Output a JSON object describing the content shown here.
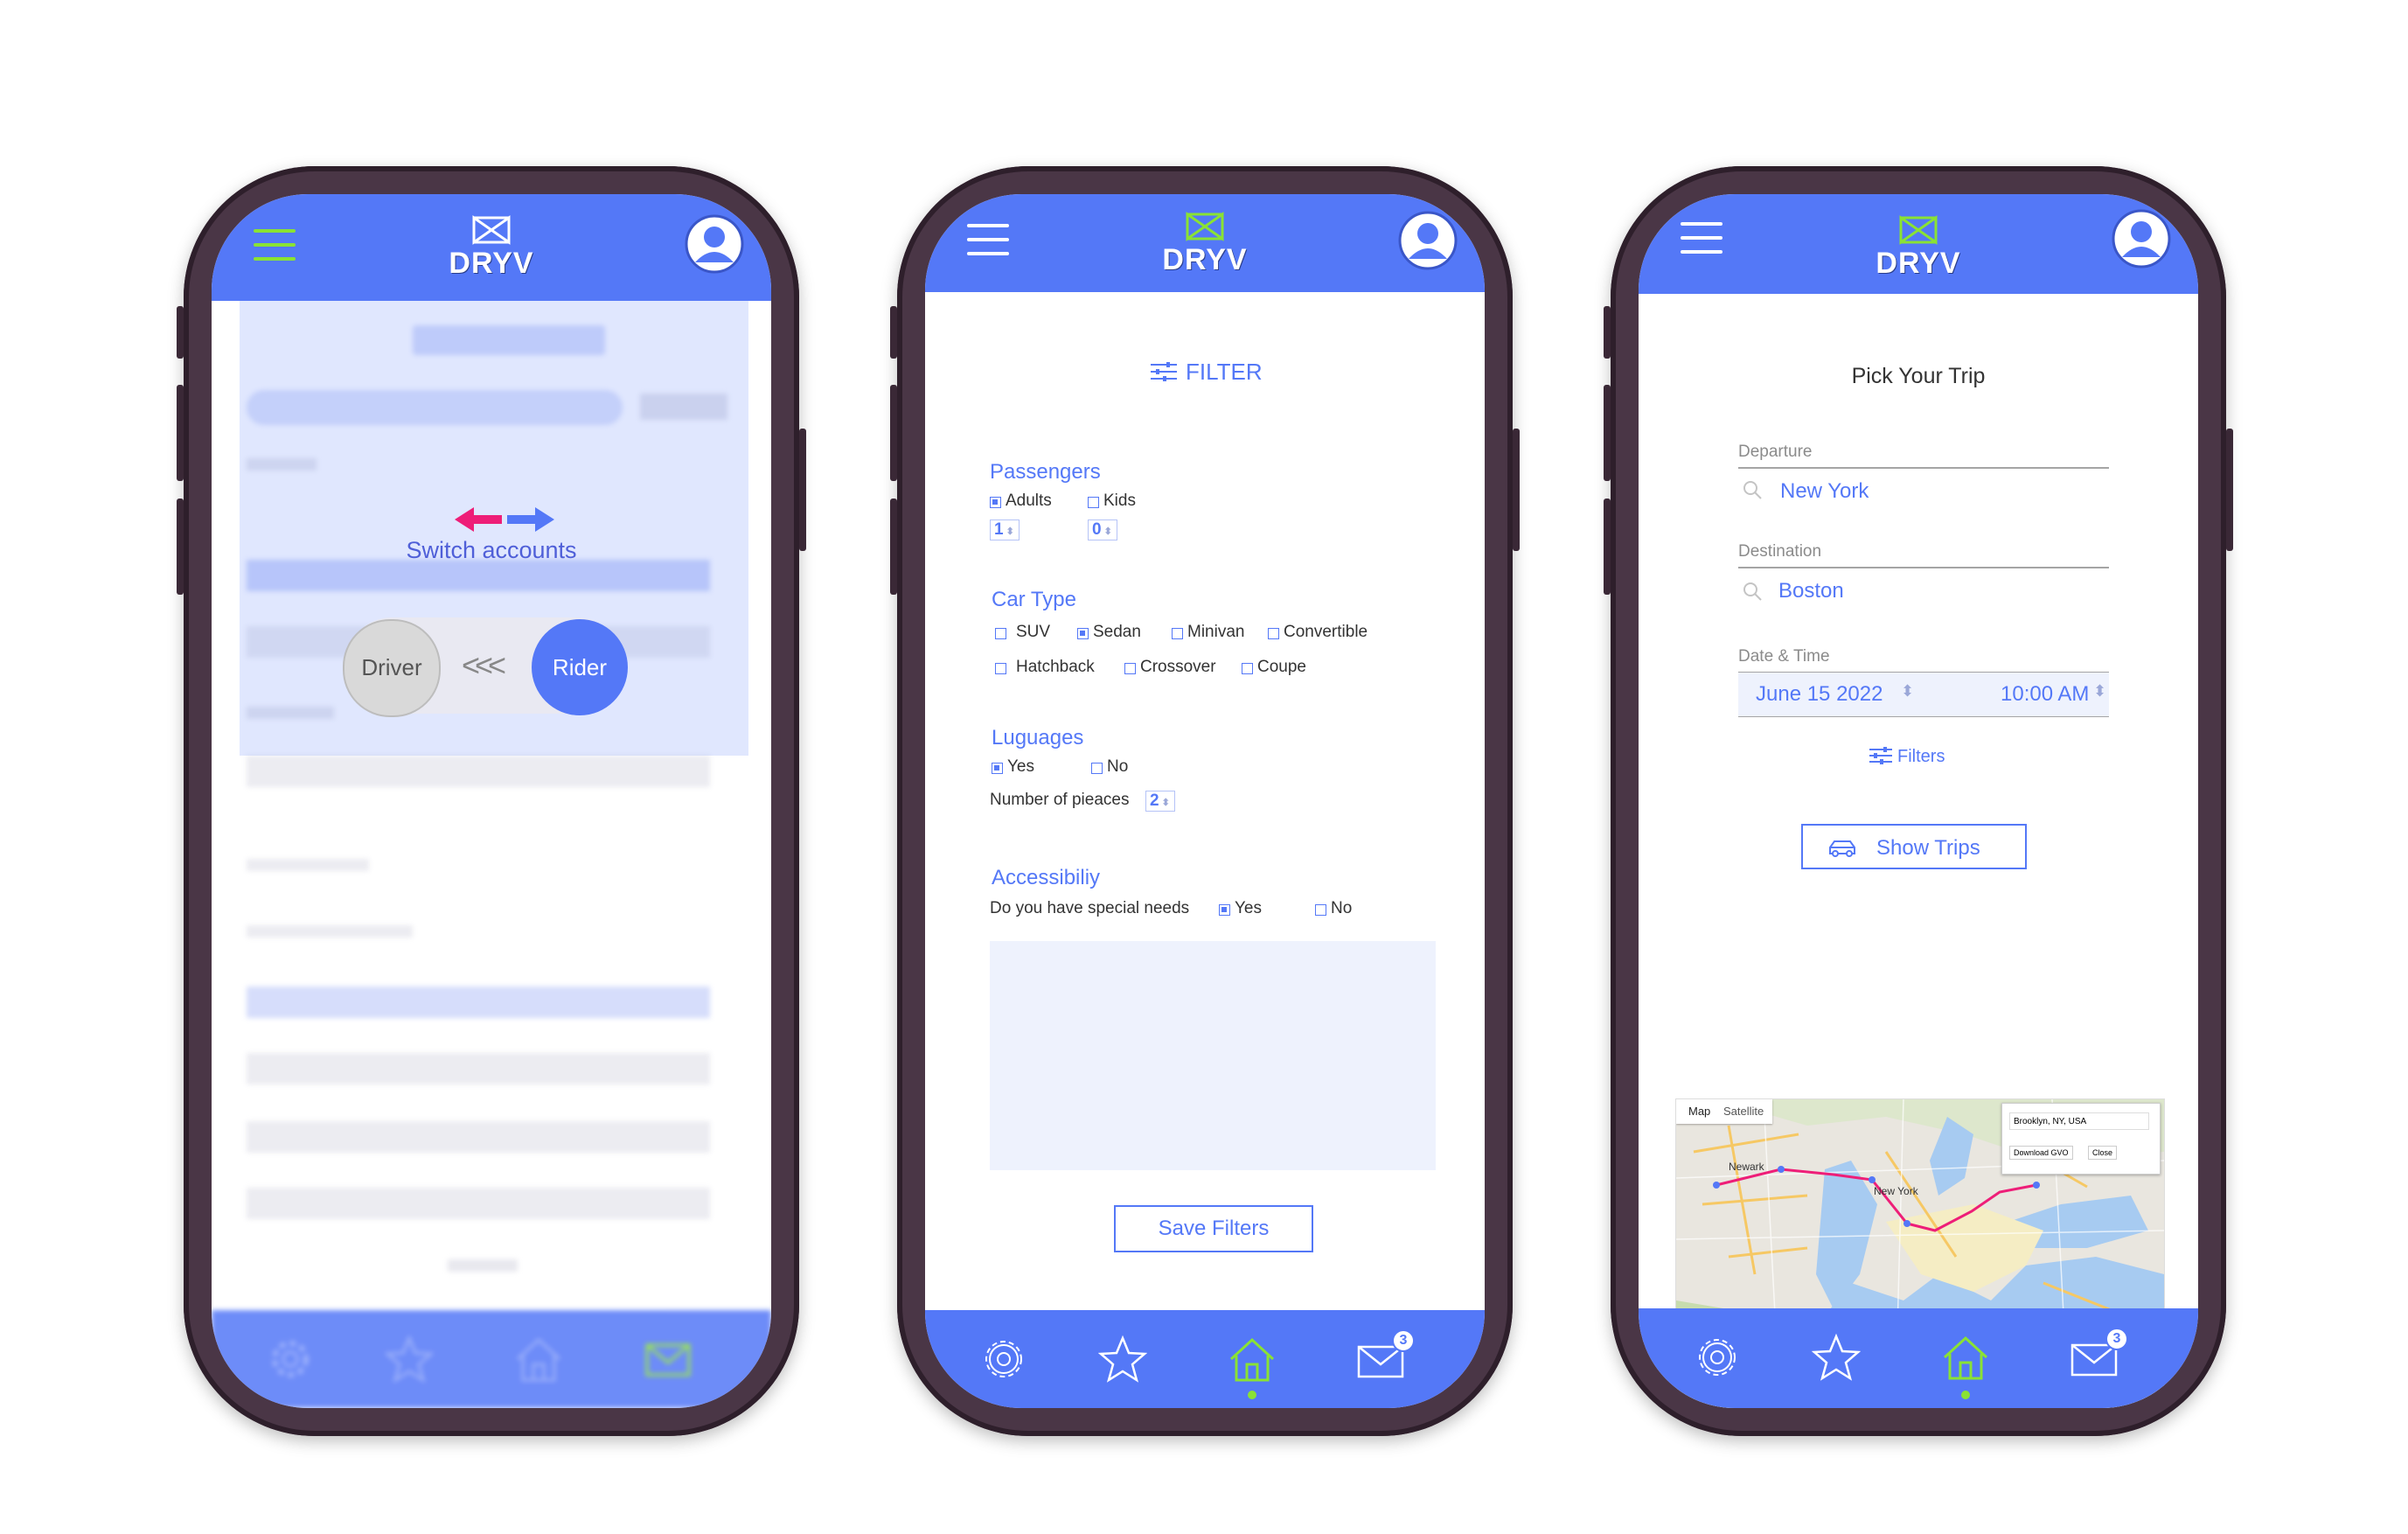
{
  "app": {
    "logo_text": "DRYV"
  },
  "colors": {
    "primary": "#5478f7",
    "accent_green": "#8ae234",
    "pink": "#ee1e78"
  },
  "bottom_nav": {
    "items": [
      "settings-icon",
      "star-icon",
      "home-icon",
      "mail-icon"
    ],
    "mail_badge": "3"
  },
  "screen1": {
    "switch_label": "Switch accounts",
    "driver_label": "Driver",
    "rider_label": "Rider",
    "chevrons": "<<<"
  },
  "screen2": {
    "filter_title": "FILTER",
    "passengers": {
      "title": "Passengers",
      "adults_label": "Adults",
      "adults_checked": true,
      "adults_value": "1",
      "kids_label": "Kids",
      "kids_checked": false,
      "kids_value": "0"
    },
    "car_type": {
      "title": "Car Type",
      "options": [
        {
          "label": "SUV",
          "checked": false
        },
        {
          "label": "Sedan",
          "checked": true
        },
        {
          "label": "Minivan",
          "checked": false
        },
        {
          "label": "Convertible",
          "checked": false
        },
        {
          "label": "Hatchback",
          "checked": false
        },
        {
          "label": "Crossover",
          "checked": false
        },
        {
          "label": "Coupe",
          "checked": false
        }
      ]
    },
    "luggages": {
      "title": "Luguages",
      "yes_label": "Yes",
      "yes_checked": true,
      "no_label": "No",
      "no_checked": false,
      "pieces_label": "Number of pieaces",
      "pieces_value": "2"
    },
    "accessibility": {
      "title": "Accessibiliy",
      "question": "Do you have special needs",
      "yes_label": "Yes",
      "yes_checked": true,
      "no_label": "No",
      "no_checked": false
    },
    "save_button": "Save Filters"
  },
  "screen3": {
    "title": "Pick Your Trip",
    "departure_label": "Departure",
    "departure_value": "New York",
    "destination_label": "Destination",
    "destination_value": "Boston",
    "datetime_label": "Date & Time",
    "date_value": "June 15 2022",
    "time_value": "10:00 AM",
    "filters_link": "Filters",
    "show_trips_button": "Show Trips",
    "map": {
      "tab_map": "Map",
      "tab_satellite": "Satellite",
      "popup_address": "Brooklyn, NY, USA",
      "popup_download": "Download GVO",
      "popup_close": "Close",
      "label_newark": "Newark",
      "label_newyork": "New York",
      "zoom_in": "+",
      "zoom_out": "−"
    }
  }
}
